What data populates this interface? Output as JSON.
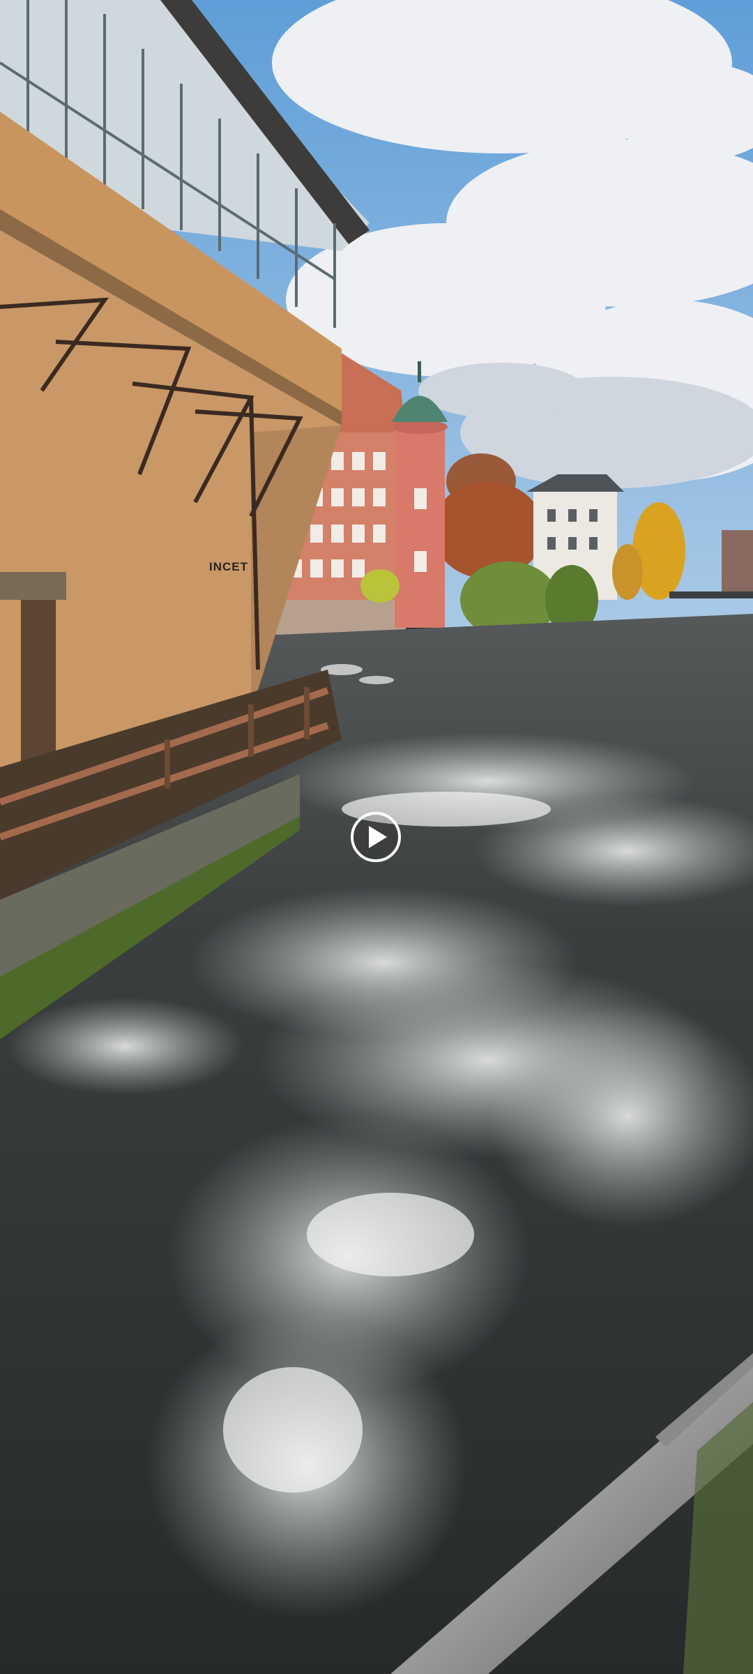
{
  "media": {
    "type": "video",
    "state": "paused"
  },
  "overlay": {
    "play_icon": "play-icon"
  },
  "scene": {
    "building_sign": "INCET"
  },
  "colors": {
    "sky": "#7fb0e0",
    "cloud": "#eef1f4",
    "facade": "#c9955e",
    "tower": "#d47a6a",
    "water": "#3a3f42",
    "foam": "#e9eeee"
  }
}
